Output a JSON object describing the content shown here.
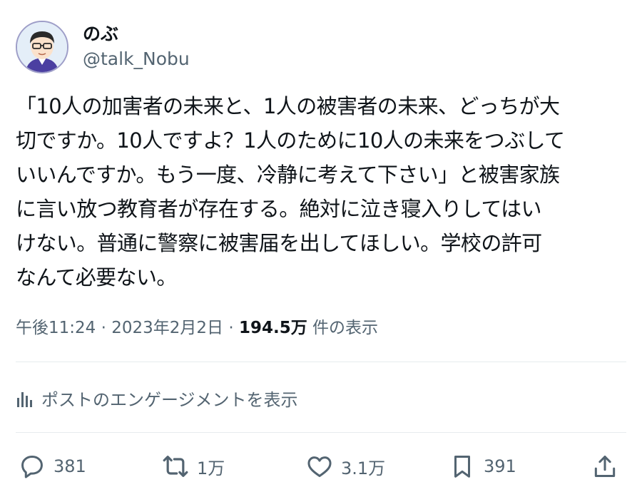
{
  "user": {
    "display_name": "のぶ",
    "handle": "@talk_Nobu"
  },
  "tweet": {
    "lines": [
      "「10人の加害者の未来と、1人の被害者の未来、どっちが大",
      "切ですか。10人ですよ？1人のために10人の未来をつぶして",
      "いいんですか。もう一度、冷静に考えて下さい」と被害家族",
      "に言い放つ教育者が存在する。絶対に泣き寝入りしてはい",
      "けない。普通に警察に被害届を出してほしい。学校の許可",
      "なんて必要ない。"
    ]
  },
  "meta": {
    "time": "午後11:24",
    "separator": " · ",
    "date": "2023年2月2日",
    "views_count": "194.5万",
    "views_label": " 件の表示"
  },
  "engagement": {
    "label": "ポストのエンゲージメントを表示",
    "icon": "analytics-icon"
  },
  "actions": {
    "reply": {
      "count": "381",
      "icon": "reply-icon"
    },
    "repost": {
      "count": "1万",
      "icon": "repost-icon"
    },
    "like": {
      "count": "3.1万",
      "icon": "heart-icon"
    },
    "bookmark": {
      "count": "391",
      "icon": "bookmark-icon"
    },
    "share": {
      "icon": "share-icon"
    }
  },
  "colors": {
    "text": "#0f1419",
    "secondary": "#536471",
    "divider": "#e7ebee"
  }
}
